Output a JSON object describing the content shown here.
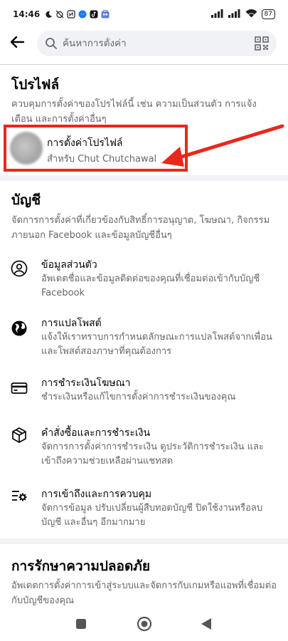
{
  "status_bar": {
    "time": "14:46",
    "battery": "87"
  },
  "search": {
    "placeholder": "ค้นหาการตั้งค่า"
  },
  "profile_section": {
    "title": "โปรไฟล์",
    "description": "ควบคุมการตั้งค่าของโปรไฟล์นี้ เช่น ความเป็นส่วนตัว การแจ้งเตือน และการตั้งค่าอื่นๆ",
    "item_title": "การตั้งค่าโปรไฟล์",
    "item_subtitle": "สำหรับ Chut Chutchawal"
  },
  "account_section": {
    "title": "บัญชี",
    "description": "จัดการการตั้งค่าที่เกี่ยวข้องกับสิทธิ์การอนุญาต, โฆษณา, กิจกรรมภายนอก Facebook และข้อมูลบัญชีอื่นๆ",
    "items": [
      {
        "icon": "person-circle-icon",
        "title": "ข้อมูลส่วนตัว",
        "description": "อัพเดตชื่อและข้อมูลติดต่อของคุณที่เชื่อมต่อเข้ากับบัญชี Facebook"
      },
      {
        "icon": "globe-icon",
        "title": "การแปลโพสต์",
        "description": "แจ้งให้เราทราบการกำหนดลักษณะการแปลโพสต์จากเพื่อนและโพสต์สองภาษาที่คุณต้องการ"
      },
      {
        "icon": "credit-card-icon",
        "title": "การชำระเงินโฆษณา",
        "description": "ชำระเงินหรือแก้ไขการตั้งค่าการชำระเงินของคุณ"
      },
      {
        "icon": "package-icon",
        "title": "คำสั่งซื้อและการชำระเงิน",
        "description": "จัดการการตั้งค่าการชำระเงิน ดูประวัติการชำระเงิน และเข้าถึงความช่วยเหลือผ่านแชทสด"
      },
      {
        "icon": "access-settings-icon",
        "title": "การเข้าถึงและการควบคุม",
        "description": "จัดการข้อมูล ปรับเปลี่ยนผู้สืบทอดบัญชี ปิดใช้งานหรือลบบัญชี และอื่นๆ อีกมากมาย"
      }
    ]
  },
  "security_section": {
    "title": "การรักษาความปลอดภัย",
    "description": "อัพเดตการตั้งค่าการเข้าสู่ระบบและจัดการกับเกมหรือแอพที่เชื่อมต่อกับบัญชีของคุณ"
  }
}
